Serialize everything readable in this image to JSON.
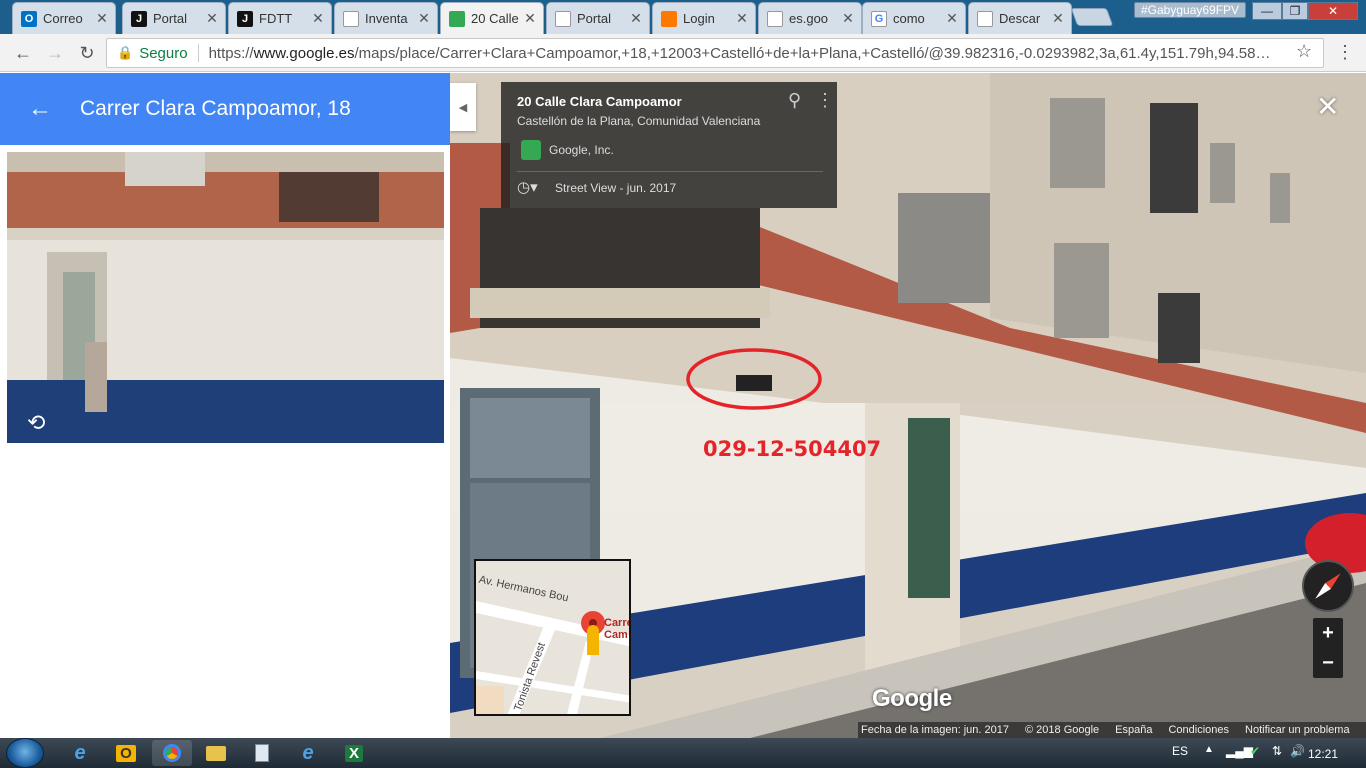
{
  "browser": {
    "tabs": [
      {
        "title": "Correo",
        "favicon": "outlook-icon",
        "color": "#0072c6",
        "glyph": "O"
      },
      {
        "title": "Portal",
        "favicon": "portal-j-icon",
        "color": "#111111",
        "glyph": "J"
      },
      {
        "title": "FDTT",
        "favicon": "portal-j-icon",
        "color": "#111111",
        "glyph": "J"
      },
      {
        "title": "Inventa",
        "favicon": "document-icon",
        "color": "#ffffff",
        "glyph": ""
      },
      {
        "title": "20 Calle",
        "favicon": "google-maps-icon",
        "color": "#34a853",
        "glyph": ""
      },
      {
        "title": "Portal",
        "favicon": "document-icon",
        "color": "#ffffff",
        "glyph": ""
      },
      {
        "title": "Login",
        "favicon": "orange-icon",
        "color": "#ff7900",
        "glyph": ""
      },
      {
        "title": "es.goo",
        "favicon": "search-icon",
        "color": "#ffffff",
        "glyph": ""
      },
      {
        "title": "como",
        "favicon": "google-icon",
        "color": "#ffffff",
        "glyph": "G"
      },
      {
        "title": "Descar",
        "favicon": "download-icon",
        "color": "#ffffff",
        "glyph": ""
      }
    ],
    "profile_name": "#Gabyguay69FPV",
    "secure_label": "Seguro",
    "url_prefix": "https://",
    "url_host": "www.google.es",
    "url_path": "/maps/place/Carrer+Clara+Campoamor,+18,+12003+Castelló+de+la+Plana,+Castelló/@39.982316,-0.0293982,3a,61.4y,151.79h,94.58…"
  },
  "left_panel": {
    "title": "Carrer Clara Campoamor, 18"
  },
  "street_view": {
    "info_title": "20 Calle Clara Campoamor",
    "info_subtitle": "Castellón de la Plana, Comunidad Valenciana",
    "owner": "Google, Inc.",
    "capture_date": "Street View - jun. 2017",
    "annotation_text": "029-12-504407",
    "annotation_color": "#e5242a",
    "minimap_street1": "Av. Hermanos Bou",
    "minimap_street2": "Tonista Revest",
    "minimap_label": "Carrer Cam",
    "google_logo": "Google",
    "zoom_in": "+",
    "zoom_out": "−",
    "footer": {
      "image_date": "Fecha de la imagen: jun. 2017",
      "copyright": "© 2018 Google",
      "country": "España",
      "terms": "Condiciones",
      "report": "Notificar un problema"
    }
  },
  "taskbar": {
    "language": "ES",
    "time": "12:21"
  }
}
